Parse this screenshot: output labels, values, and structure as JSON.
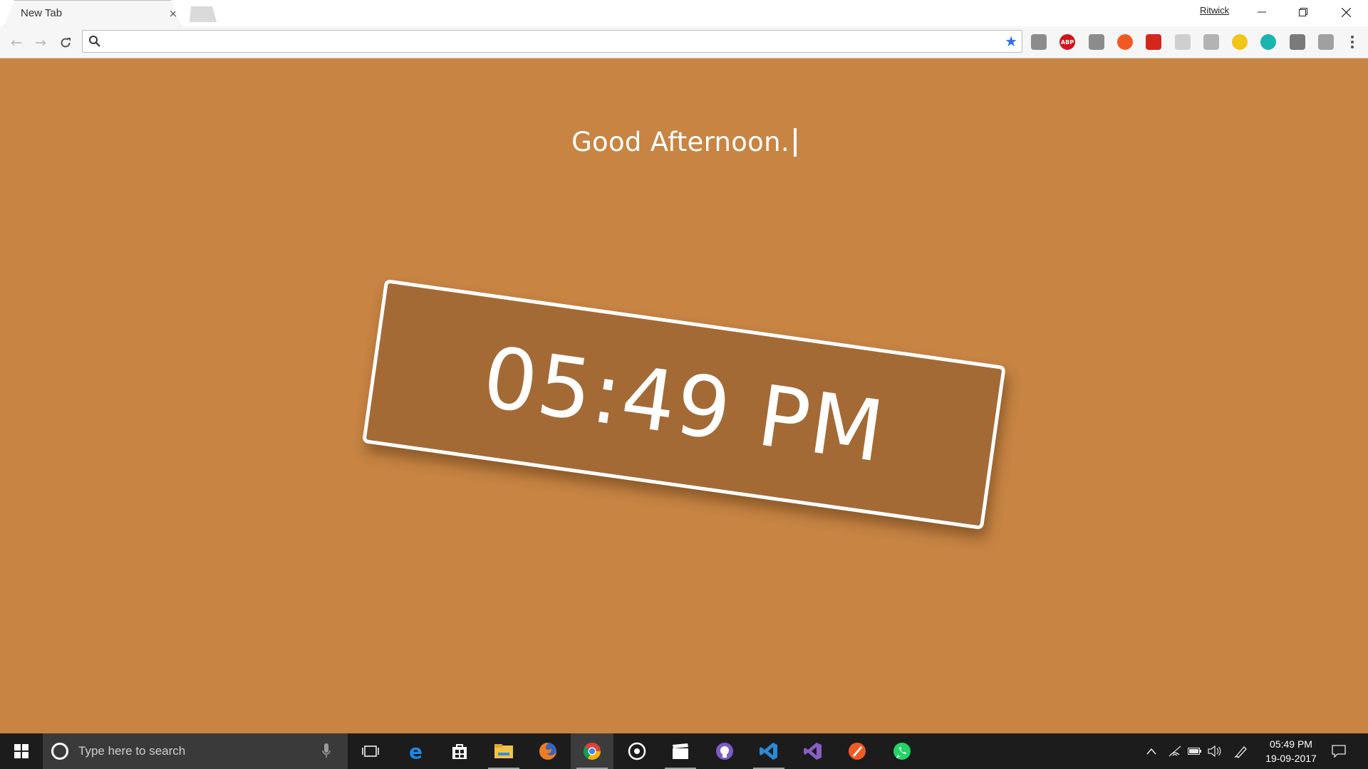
{
  "browser": {
    "tab_title": "New Tab",
    "tab_close": "×",
    "profile_name": "Ritwick",
    "omnibox": {
      "value": "",
      "placeholder": ""
    },
    "extensions": [
      {
        "name": "world-icon",
        "color": "#8c8c8c"
      },
      {
        "name": "adblock-plus-icon",
        "label": "ABP",
        "color": "#d3121b"
      },
      {
        "name": "tab-manager-icon",
        "color": "#8c8c8c"
      },
      {
        "name": "ubuntu-icon",
        "color": "#f05a22"
      },
      {
        "name": "pdf-icon",
        "color": "#d6261b"
      },
      {
        "name": "feather-icon",
        "color": "#cfcfcf"
      },
      {
        "name": "snippet-icon",
        "color": "#b3b3b3"
      },
      {
        "name": "night-mode-icon",
        "color": "#f2c519"
      },
      {
        "name": "m-circle-icon",
        "color": "#19b5b0"
      },
      {
        "name": "gear-extension-icon",
        "color": "#7a7a7a"
      },
      {
        "name": "pencil-icon",
        "color": "#a0a0a0"
      }
    ]
  },
  "page": {
    "greeting": "Good Afternoon.",
    "clock": "05:49 PM",
    "background_color": "#c78443",
    "clock_box_color": "#a46a35"
  },
  "taskbar": {
    "search_placeholder": "Type here to search",
    "apps": [
      {
        "name": "task-view-icon"
      },
      {
        "name": "edge-icon"
      },
      {
        "name": "store-icon"
      },
      {
        "name": "file-explorer-icon"
      },
      {
        "name": "firefox-icon"
      },
      {
        "name": "chrome-icon"
      },
      {
        "name": "groove-music-icon"
      },
      {
        "name": "movies-tv-icon"
      },
      {
        "name": "github-icon"
      },
      {
        "name": "vscode-icon"
      },
      {
        "name": "visual-studio-icon"
      },
      {
        "name": "paint-icon"
      },
      {
        "name": "whatsapp-icon"
      }
    ],
    "time": "05:49 PM",
    "date": "19-09-2017"
  }
}
